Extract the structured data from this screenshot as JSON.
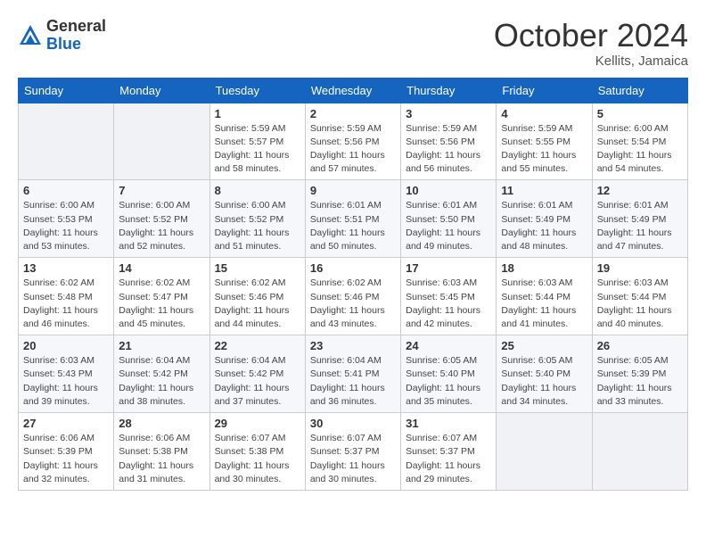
{
  "header": {
    "logo_general": "General",
    "logo_blue": "Blue",
    "month_title": "October 2024",
    "location": "Kellits, Jamaica"
  },
  "weekdays": [
    "Sunday",
    "Monday",
    "Tuesday",
    "Wednesday",
    "Thursday",
    "Friday",
    "Saturday"
  ],
  "weeks": [
    [
      {
        "day": "",
        "info": ""
      },
      {
        "day": "",
        "info": ""
      },
      {
        "day": "1",
        "info": "Sunrise: 5:59 AM\nSunset: 5:57 PM\nDaylight: 11 hours and 58 minutes."
      },
      {
        "day": "2",
        "info": "Sunrise: 5:59 AM\nSunset: 5:56 PM\nDaylight: 11 hours and 57 minutes."
      },
      {
        "day": "3",
        "info": "Sunrise: 5:59 AM\nSunset: 5:56 PM\nDaylight: 11 hours and 56 minutes."
      },
      {
        "day": "4",
        "info": "Sunrise: 5:59 AM\nSunset: 5:55 PM\nDaylight: 11 hours and 55 minutes."
      },
      {
        "day": "5",
        "info": "Sunrise: 6:00 AM\nSunset: 5:54 PM\nDaylight: 11 hours and 54 minutes."
      }
    ],
    [
      {
        "day": "6",
        "info": "Sunrise: 6:00 AM\nSunset: 5:53 PM\nDaylight: 11 hours and 53 minutes."
      },
      {
        "day": "7",
        "info": "Sunrise: 6:00 AM\nSunset: 5:52 PM\nDaylight: 11 hours and 52 minutes."
      },
      {
        "day": "8",
        "info": "Sunrise: 6:00 AM\nSunset: 5:52 PM\nDaylight: 11 hours and 51 minutes."
      },
      {
        "day": "9",
        "info": "Sunrise: 6:01 AM\nSunset: 5:51 PM\nDaylight: 11 hours and 50 minutes."
      },
      {
        "day": "10",
        "info": "Sunrise: 6:01 AM\nSunset: 5:50 PM\nDaylight: 11 hours and 49 minutes."
      },
      {
        "day": "11",
        "info": "Sunrise: 6:01 AM\nSunset: 5:49 PM\nDaylight: 11 hours and 48 minutes."
      },
      {
        "day": "12",
        "info": "Sunrise: 6:01 AM\nSunset: 5:49 PM\nDaylight: 11 hours and 47 minutes."
      }
    ],
    [
      {
        "day": "13",
        "info": "Sunrise: 6:02 AM\nSunset: 5:48 PM\nDaylight: 11 hours and 46 minutes."
      },
      {
        "day": "14",
        "info": "Sunrise: 6:02 AM\nSunset: 5:47 PM\nDaylight: 11 hours and 45 minutes."
      },
      {
        "day": "15",
        "info": "Sunrise: 6:02 AM\nSunset: 5:46 PM\nDaylight: 11 hours and 44 minutes."
      },
      {
        "day": "16",
        "info": "Sunrise: 6:02 AM\nSunset: 5:46 PM\nDaylight: 11 hours and 43 minutes."
      },
      {
        "day": "17",
        "info": "Sunrise: 6:03 AM\nSunset: 5:45 PM\nDaylight: 11 hours and 42 minutes."
      },
      {
        "day": "18",
        "info": "Sunrise: 6:03 AM\nSunset: 5:44 PM\nDaylight: 11 hours and 41 minutes."
      },
      {
        "day": "19",
        "info": "Sunrise: 6:03 AM\nSunset: 5:44 PM\nDaylight: 11 hours and 40 minutes."
      }
    ],
    [
      {
        "day": "20",
        "info": "Sunrise: 6:03 AM\nSunset: 5:43 PM\nDaylight: 11 hours and 39 minutes."
      },
      {
        "day": "21",
        "info": "Sunrise: 6:04 AM\nSunset: 5:42 PM\nDaylight: 11 hours and 38 minutes."
      },
      {
        "day": "22",
        "info": "Sunrise: 6:04 AM\nSunset: 5:42 PM\nDaylight: 11 hours and 37 minutes."
      },
      {
        "day": "23",
        "info": "Sunrise: 6:04 AM\nSunset: 5:41 PM\nDaylight: 11 hours and 36 minutes."
      },
      {
        "day": "24",
        "info": "Sunrise: 6:05 AM\nSunset: 5:40 PM\nDaylight: 11 hours and 35 minutes."
      },
      {
        "day": "25",
        "info": "Sunrise: 6:05 AM\nSunset: 5:40 PM\nDaylight: 11 hours and 34 minutes."
      },
      {
        "day": "26",
        "info": "Sunrise: 6:05 AM\nSunset: 5:39 PM\nDaylight: 11 hours and 33 minutes."
      }
    ],
    [
      {
        "day": "27",
        "info": "Sunrise: 6:06 AM\nSunset: 5:39 PM\nDaylight: 11 hours and 32 minutes."
      },
      {
        "day": "28",
        "info": "Sunrise: 6:06 AM\nSunset: 5:38 PM\nDaylight: 11 hours and 31 minutes."
      },
      {
        "day": "29",
        "info": "Sunrise: 6:07 AM\nSunset: 5:38 PM\nDaylight: 11 hours and 30 minutes."
      },
      {
        "day": "30",
        "info": "Sunrise: 6:07 AM\nSunset: 5:37 PM\nDaylight: 11 hours and 30 minutes."
      },
      {
        "day": "31",
        "info": "Sunrise: 6:07 AM\nSunset: 5:37 PM\nDaylight: 11 hours and 29 minutes."
      },
      {
        "day": "",
        "info": ""
      },
      {
        "day": "",
        "info": ""
      }
    ]
  ]
}
